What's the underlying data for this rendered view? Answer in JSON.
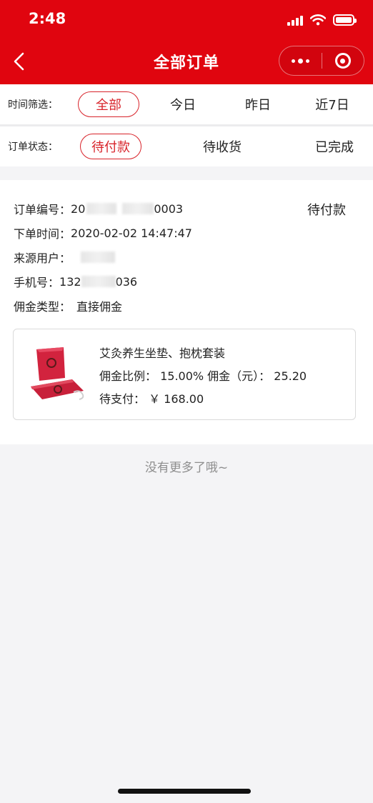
{
  "status_bar": {
    "time": "2:48"
  },
  "header": {
    "title": "全部订单"
  },
  "filters": {
    "time_label": "时间筛选：",
    "time_options": [
      "全部",
      "今日",
      "昨日",
      "近7日"
    ],
    "status_label": "订单状态：",
    "status_options": [
      "待付款",
      "待收货",
      "已完成"
    ]
  },
  "order": {
    "order_no_label": "订单编号：",
    "order_no_prefix": "20",
    "order_no_suffix": "0003",
    "status": "待付款",
    "time_label": "下单时间：",
    "time_value": "2020-02-02 14:47:47",
    "user_label": "来源用户：",
    "phone_label": "手机号：",
    "phone_prefix": "132",
    "phone_suffix": "036",
    "commission_type_label": "佣金类型：",
    "commission_type_value": "直接佣金",
    "product": {
      "name": "艾灸养生坐垫、抱枕套装",
      "rate_line": "佣金比例： 15.00% 佣金（元）： 25.20",
      "pay_line": "待支付： ￥ 168.00"
    }
  },
  "footer": {
    "no_more": "没有更多了哦~"
  },
  "colors": {
    "brand_red": "#e0050f",
    "active_red": "#d8232a"
  }
}
